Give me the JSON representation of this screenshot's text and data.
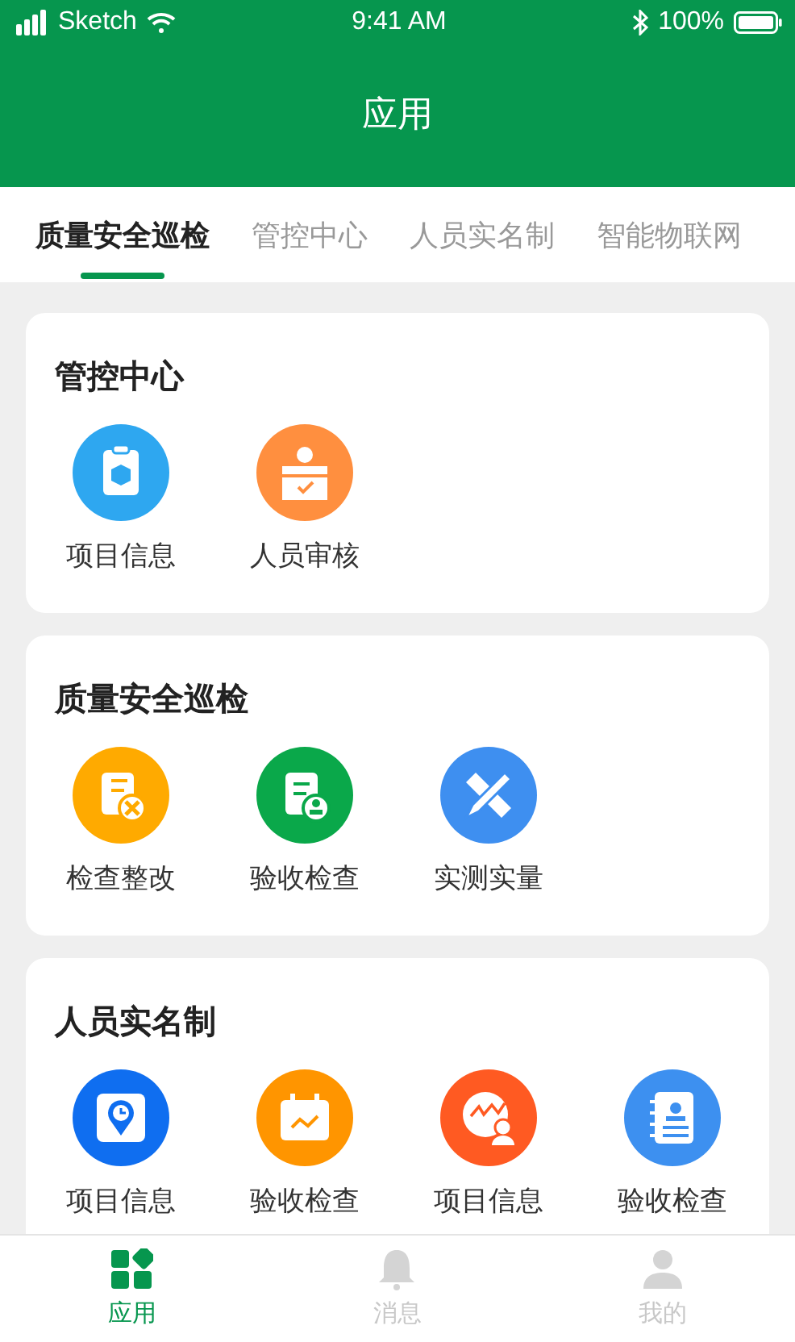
{
  "status_bar": {
    "carrier": "Sketch",
    "time": "9:41 AM",
    "battery": "100%"
  },
  "header": {
    "title": "应用"
  },
  "tabs": [
    {
      "label": "质量安全巡检",
      "selected": true
    },
    {
      "label": "管控中心",
      "selected": false
    },
    {
      "label": "人员实名制",
      "selected": false
    },
    {
      "label": "智能物联网",
      "selected": false
    }
  ],
  "sections": [
    {
      "title": "管控中心",
      "items": [
        {
          "label": "项目信息",
          "kind": "clipboard",
          "color": "#2ea7f0"
        },
        {
          "label": "人员审核",
          "kind": "person",
          "color": "#ff8f3f"
        }
      ]
    },
    {
      "title": "质量安全巡检",
      "items": [
        {
          "label": "检查整改",
          "kind": "tools",
          "color": "#ffaa00"
        },
        {
          "label": "验收检查",
          "kind": "stamp",
          "color": "#0aa84a"
        },
        {
          "label": "实测实量",
          "kind": "ruler",
          "color": "#3e8ff0"
        }
      ]
    },
    {
      "title": "人员实名制",
      "items": [
        {
          "label": "项目信息",
          "kind": "clock",
          "color": "#0f6ef0"
        },
        {
          "label": "验收检查",
          "kind": "calendar",
          "color": "#ff9500"
        },
        {
          "label": "项目信息",
          "kind": "chart",
          "color": "#ff5a22"
        },
        {
          "label": "验收检查",
          "kind": "contacts",
          "color": "#3d90f0"
        }
      ]
    }
  ],
  "bottom_nav": [
    {
      "label": "应用",
      "kind": "grid",
      "selected": true
    },
    {
      "label": "消息",
      "kind": "bell",
      "selected": false
    },
    {
      "label": "我的",
      "kind": "person",
      "selected": false
    }
  ]
}
